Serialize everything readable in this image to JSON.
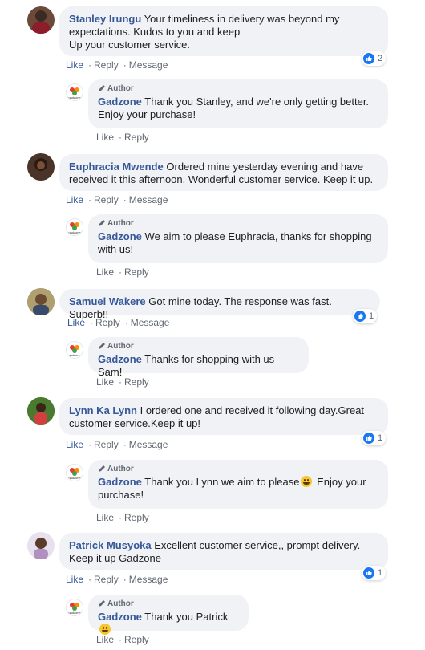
{
  "actions": {
    "like": "Like",
    "reply": "Reply",
    "message": "Message"
  },
  "author_badge": "Author",
  "brand_name": "Gadzone",
  "brand_logo_text": "gadzone",
  "comments": [
    {
      "name": "Stanley Irungu",
      "text": "Your timeliness in delivery was beyond my expectations. Kudos to you and keep",
      "text2": "Up your customer service.",
      "reactions": "2",
      "reply": "Thank you Stanley, and we're only getting better. Enjoy your purchase!"
    },
    {
      "name": "Euphracia Mwende",
      "text": "Ordered mine yesterday evening and have received it this afternoon. Wonderful customer service. Keep it up.",
      "reply": "We aim to please Euphracia, thanks for shopping with us!"
    },
    {
      "name": "Samuel Wakere",
      "text": "Got mine today. The response was fast. Superb!!",
      "reactions": "1",
      "reply": "Thanks for shopping with us Sam!"
    },
    {
      "name": "Lynn Ka Lynn",
      "text": "I ordered one and received it following day.Great customer service.Keep it up!",
      "reactions": "1",
      "reply_a": "Thank you Lynn we aim to please",
      "reply_b": "Enjoy your purchase!"
    },
    {
      "name": "Patrick Musyoka",
      "text": "Excellent customer service,, prompt delivery. Keep it up Gadzone",
      "reactions": "1",
      "reply": "Thank you Patrick"
    }
  ]
}
